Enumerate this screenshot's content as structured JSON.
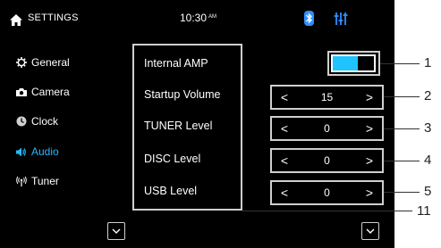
{
  "status_bar": {
    "title": "SETTINGS",
    "time": "10:30",
    "ampm": "AM",
    "icons": [
      "home-icon",
      "bluetooth-icon",
      "equalizer-icon"
    ]
  },
  "sidebar": {
    "items": [
      {
        "label": "General",
        "icon": "gear-icon",
        "active": false
      },
      {
        "label": "Camera",
        "icon": "camera-icon",
        "active": false
      },
      {
        "label": "Clock",
        "icon": "clock-icon",
        "active": false
      },
      {
        "label": "Audio",
        "icon": "speaker-icon",
        "active": true
      },
      {
        "label": "Tuner",
        "icon": "antenna-icon",
        "active": false
      }
    ]
  },
  "settings": {
    "internal_amp": {
      "label": "Internal AMP",
      "state": "on"
    },
    "startup_volume": {
      "label": "Startup Volume",
      "value": "15"
    },
    "tuner_level": {
      "label": "TUNER Level",
      "value": "0"
    },
    "disc_level": {
      "label": "DISC Level",
      "value": "0"
    },
    "usb_level": {
      "label": "USB Level",
      "value": "0"
    }
  },
  "stepper_glyphs": {
    "prev": "<",
    "next": ">"
  },
  "callouts": [
    "1",
    "2",
    "3",
    "4",
    "5",
    "11"
  ],
  "colors": {
    "accent": "#29b6ff",
    "toggle_fill": "#1fc4ff",
    "bluetooth": "#2f8fff",
    "equalizer": "#2f8fff",
    "background": "#000000"
  }
}
